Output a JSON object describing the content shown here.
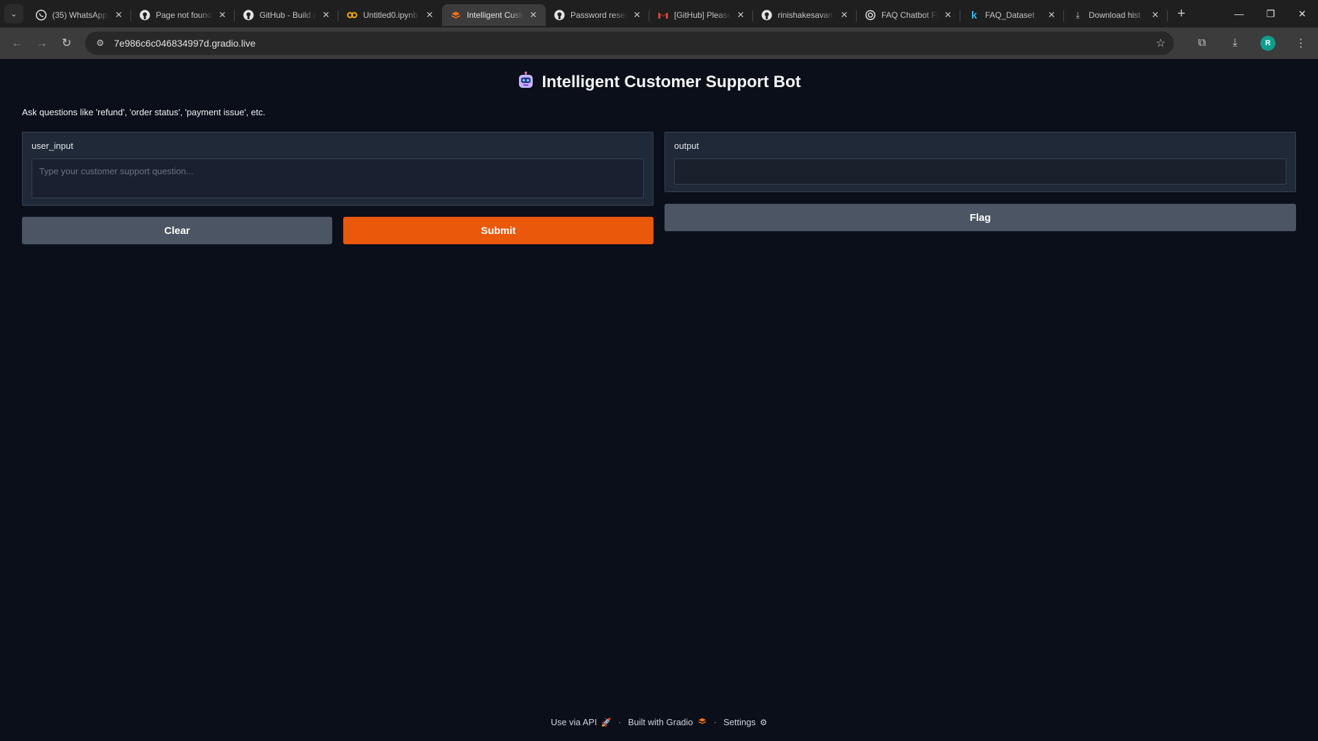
{
  "browser": {
    "tabs": [
      {
        "title": "(35) WhatsApp",
        "icon": "whatsapp-icon",
        "active": false
      },
      {
        "title": "Page not found",
        "icon": "github-icon",
        "active": false
      },
      {
        "title": "GitHub - Build and",
        "icon": "github-icon",
        "active": false
      },
      {
        "title": "Untitled0.ipynb",
        "icon": "colab-icon",
        "active": false
      },
      {
        "title": "Intelligent Customer",
        "icon": "gradio-icon",
        "active": true
      },
      {
        "title": "Password reset",
        "icon": "github-icon",
        "active": false
      },
      {
        "title": "[GitHub] Please",
        "icon": "gmail-icon",
        "active": false
      },
      {
        "title": "rinishakesavan",
        "icon": "github-icon",
        "active": false
      },
      {
        "title": "FAQ Chatbot Fi",
        "icon": "openai-icon",
        "active": false
      },
      {
        "title": "FAQ_Dataset",
        "icon": "kaggle-icon",
        "active": false
      },
      {
        "title": "Download hist",
        "icon": "download-icon",
        "active": false
      }
    ],
    "url": "7e986c6c046834997d.gradio.live",
    "profile_initial": "R"
  },
  "app": {
    "title": "Intelligent Customer Support Bot",
    "description": "Ask questions like 'refund', 'order status', 'payment issue', etc.",
    "input_label": "user_input",
    "input_placeholder": "Type your customer support question...",
    "input_value": "",
    "output_label": "output",
    "output_value": "",
    "clear_label": "Clear",
    "submit_label": "Submit",
    "flag_label": "Flag"
  },
  "footer": {
    "api_label": "Use via API",
    "built_label": "Built with Gradio",
    "settings_label": "Settings",
    "separator": "·"
  },
  "colors": {
    "submit": "#ea580c",
    "secondary_button": "#4b5563",
    "background": "#0b0f19"
  }
}
